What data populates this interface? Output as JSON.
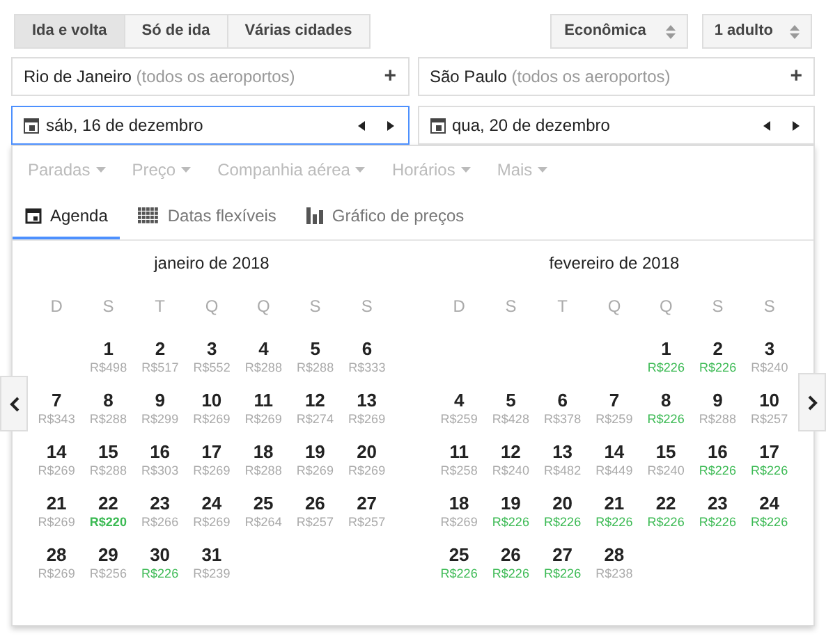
{
  "trip_types": [
    {
      "label": "Ida e volta",
      "selected": true
    },
    {
      "label": "Só de ida",
      "selected": false
    },
    {
      "label": "Várias cidades",
      "selected": false
    }
  ],
  "cabin": "Econômica",
  "passengers": "1 adulto",
  "origin": {
    "city": "Rio de Janeiro",
    "note": "(todos os aeroportos)",
    "action": "+"
  },
  "destination": {
    "city": "São Paulo",
    "note": "(todos os aeroportos)",
    "action": "+"
  },
  "dates": [
    {
      "label": "sáb, 16 de dezembro",
      "selected": true
    },
    {
      "label": "qua, 20 de dezembro",
      "selected": false
    }
  ],
  "filters": [
    "Paradas",
    "Preço",
    "Companhia aérea",
    "Horários",
    "Mais"
  ],
  "views": [
    {
      "label": "Agenda",
      "selected": true,
      "kind": "calendar"
    },
    {
      "label": "Datas flexíveis",
      "selected": false,
      "kind": "grid"
    },
    {
      "label": "Gráfico de preços",
      "selected": false,
      "kind": "chart"
    }
  ],
  "months": [
    {
      "title": "janeiro de 2018",
      "weekdays": [
        "D",
        "S",
        "T",
        "Q",
        "Q",
        "S",
        "S"
      ],
      "weeks": [
        [
          {
            "day": "1",
            "price": "R$498",
            "cheap": false,
            "cheapest": false
          },
          {
            "day": "2",
            "price": "R$517",
            "cheap": false,
            "cheapest": false
          },
          {
            "day": "3",
            "price": "R$552",
            "cheap": false,
            "cheapest": false
          },
          {
            "day": "4",
            "price": "R$288",
            "cheap": false,
            "cheapest": false
          },
          {
            "day": "5",
            "price": "R$288",
            "cheap": false,
            "cheapest": false
          },
          {
            "day": "6",
            "price": "R$333",
            "cheap": false,
            "cheapest": false
          }
        ],
        [
          {
            "day": "7",
            "price": "R$343",
            "cheap": false,
            "cheapest": false
          },
          {
            "day": "8",
            "price": "R$288",
            "cheap": false,
            "cheapest": false
          },
          {
            "day": "9",
            "price": "R$299",
            "cheap": false,
            "cheapest": false
          },
          {
            "day": "10",
            "price": "R$269",
            "cheap": false,
            "cheapest": false
          },
          {
            "day": "11",
            "price": "R$269",
            "cheap": false,
            "cheapest": false
          },
          {
            "day": "12",
            "price": "R$274",
            "cheap": false,
            "cheapest": false
          },
          {
            "day": "13",
            "price": "R$269",
            "cheap": false,
            "cheapest": false
          }
        ],
        [
          {
            "day": "14",
            "price": "R$269",
            "cheap": false,
            "cheapest": false
          },
          {
            "day": "15",
            "price": "R$288",
            "cheap": false,
            "cheapest": false
          },
          {
            "day": "16",
            "price": "R$303",
            "cheap": false,
            "cheapest": false
          },
          {
            "day": "17",
            "price": "R$269",
            "cheap": false,
            "cheapest": false
          },
          {
            "day": "18",
            "price": "R$288",
            "cheap": false,
            "cheapest": false
          },
          {
            "day": "19",
            "price": "R$269",
            "cheap": false,
            "cheapest": false
          },
          {
            "day": "20",
            "price": "R$269",
            "cheap": false,
            "cheapest": false
          }
        ],
        [
          {
            "day": "21",
            "price": "R$269",
            "cheap": false,
            "cheapest": false
          },
          {
            "day": "22",
            "price": "R$220",
            "cheap": true,
            "cheapest": true
          },
          {
            "day": "23",
            "price": "R$266",
            "cheap": false,
            "cheapest": false
          },
          {
            "day": "24",
            "price": "R$269",
            "cheap": false,
            "cheapest": false
          },
          {
            "day": "25",
            "price": "R$264",
            "cheap": false,
            "cheapest": false
          },
          {
            "day": "26",
            "price": "R$257",
            "cheap": false,
            "cheapest": false
          },
          {
            "day": "27",
            "price": "R$257",
            "cheap": false,
            "cheapest": false
          }
        ],
        [
          {
            "day": "28",
            "price": "R$269",
            "cheap": false,
            "cheapest": false
          },
          {
            "day": "29",
            "price": "R$256",
            "cheap": false,
            "cheapest": false
          },
          {
            "day": "30",
            "price": "R$226",
            "cheap": true,
            "cheapest": false
          },
          {
            "day": "31",
            "price": "R$239",
            "cheap": false,
            "cheapest": false
          }
        ]
      ]
    },
    {
      "title": "fevereiro de 2018",
      "weekdays": [
        "D",
        "S",
        "T",
        "Q",
        "Q",
        "S",
        "S"
      ],
      "weeks": [
        [
          {
            "day": "1",
            "price": "R$226",
            "cheap": true,
            "cheapest": false
          },
          {
            "day": "2",
            "price": "R$226",
            "cheap": true,
            "cheapest": false
          },
          {
            "day": "3",
            "price": "R$240",
            "cheap": false,
            "cheapest": false
          }
        ],
        [
          {
            "day": "4",
            "price": "R$259",
            "cheap": false,
            "cheapest": false
          },
          {
            "day": "5",
            "price": "R$428",
            "cheap": false,
            "cheapest": false
          },
          {
            "day": "6",
            "price": "R$378",
            "cheap": false,
            "cheapest": false
          },
          {
            "day": "7",
            "price": "R$259",
            "cheap": false,
            "cheapest": false
          },
          {
            "day": "8",
            "price": "R$226",
            "cheap": true,
            "cheapest": false
          },
          {
            "day": "9",
            "price": "R$288",
            "cheap": false,
            "cheapest": false
          },
          {
            "day": "10",
            "price": "R$257",
            "cheap": false,
            "cheapest": false
          }
        ],
        [
          {
            "day": "11",
            "price": "R$258",
            "cheap": false,
            "cheapest": false
          },
          {
            "day": "12",
            "price": "R$240",
            "cheap": false,
            "cheapest": false
          },
          {
            "day": "13",
            "price": "R$482",
            "cheap": false,
            "cheapest": false
          },
          {
            "day": "14",
            "price": "R$449",
            "cheap": false,
            "cheapest": false
          },
          {
            "day": "15",
            "price": "R$240",
            "cheap": false,
            "cheapest": false
          },
          {
            "day": "16",
            "price": "R$226",
            "cheap": true,
            "cheapest": false
          },
          {
            "day": "17",
            "price": "R$226",
            "cheap": true,
            "cheapest": false
          }
        ],
        [
          {
            "day": "18",
            "price": "R$269",
            "cheap": false,
            "cheapest": false
          },
          {
            "day": "19",
            "price": "R$226",
            "cheap": true,
            "cheapest": false
          },
          {
            "day": "20",
            "price": "R$226",
            "cheap": true,
            "cheapest": false
          },
          {
            "day": "21",
            "price": "R$226",
            "cheap": true,
            "cheapest": false
          },
          {
            "day": "22",
            "price": "R$226",
            "cheap": true,
            "cheapest": false
          },
          {
            "day": "23",
            "price": "R$226",
            "cheap": true,
            "cheapest": false
          },
          {
            "day": "24",
            "price": "R$226",
            "cheap": true,
            "cheapest": false
          }
        ],
        [
          {
            "day": "25",
            "price": "R$226",
            "cheap": true,
            "cheapest": false
          },
          {
            "day": "26",
            "price": "R$226",
            "cheap": true,
            "cheapest": false
          },
          {
            "day": "27",
            "price": "R$226",
            "cheap": true,
            "cheapest": false
          },
          {
            "day": "28",
            "price": "R$238",
            "cheap": false,
            "cheapest": false
          }
        ]
      ]
    }
  ]
}
